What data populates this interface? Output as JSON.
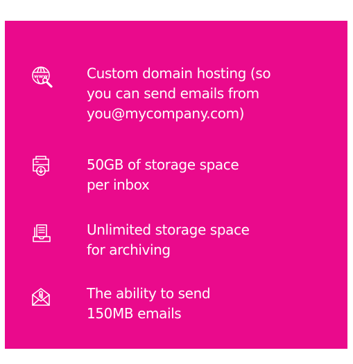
{
  "colors": {
    "panel_background": "#ea0a8c",
    "text": "#ffffff",
    "page_background": "#ffffff"
  },
  "features": [
    {
      "icon": "globe-search-icon",
      "lines": [
        "Custom domain hosting (so",
        "you can send emails from",
        "you@mycompany.com)"
      ]
    },
    {
      "icon": "storage-download-icon",
      "lines": [
        "50GB of storage space",
        "per inbox"
      ]
    },
    {
      "icon": "archive-box-icon",
      "lines": [
        "Unlimited storage space",
        "for archiving"
      ]
    },
    {
      "icon": "email-attachment-icon",
      "lines": [
        "The ability to send",
        "150MB emails"
      ]
    }
  ]
}
